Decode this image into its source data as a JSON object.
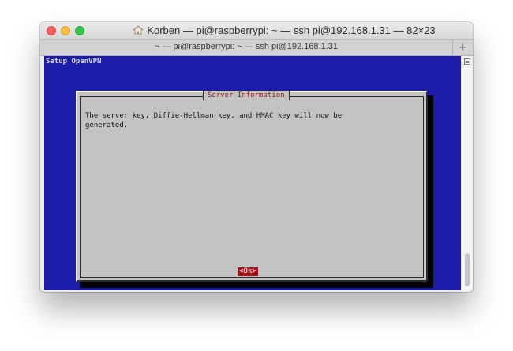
{
  "window": {
    "title": "Korben — pi@raspberrypi: ~ — ssh pi@192.168.1.31 — 82×23",
    "home_icon": "house-icon"
  },
  "tab": {
    "label": "~ — pi@raspberrypi: ~ — ssh pi@192.168.1.31",
    "new_tab_label": "+"
  },
  "terminal": {
    "screen_title": "Setup OpenVPN",
    "dialog": {
      "title": "Server Information",
      "message": "The server key, Diffie-Hellman key, and HMAC key will now be\ngenerated.",
      "ok_label": "<Ok>"
    }
  },
  "colors": {
    "terminal_background": "#1c1ca8",
    "dialog_background": "#c3c3c3",
    "dialog_title": "#8b1b1b",
    "ok_button": "#a8131b"
  }
}
